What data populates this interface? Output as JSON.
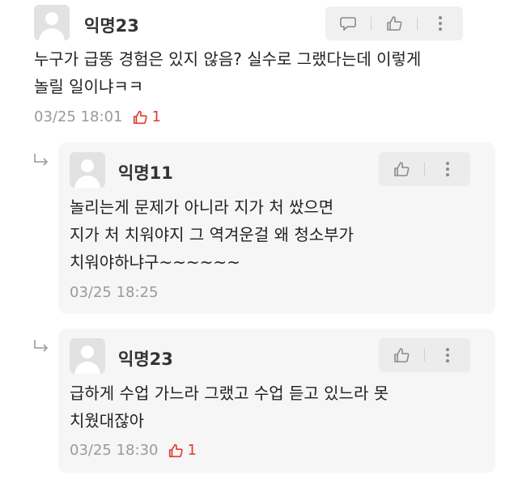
{
  "comments": [
    {
      "author": "익명23",
      "lines": [
        "누구가 급똥 경험은 있지 않음? 실수로 그랬다는데 이렇게",
        "놀릴 일이냐ㅋㅋ"
      ],
      "timestamp": "03/25 18:01",
      "likes": "1"
    }
  ],
  "replies": [
    {
      "author": "익명11",
      "lines": [
        "놀리는게 문제가 아니라 지가 처 쌌으면",
        "지가 처 치워야지 그 역겨운걸 왜 청소부가",
        "치워야하냐구~~~~~~"
      ],
      "timestamp": "03/25 18:25"
    },
    {
      "author": "익명23",
      "lines": [
        "급하게 수업 가느라 그랬고 수업 듣고 있느라 못",
        "치웠대잖아"
      ],
      "timestamp": "03/25 18:30",
      "likes": "1"
    }
  ],
  "colors": {
    "like": "#e03a2f",
    "meta": "#9a9a9a",
    "reply_bg": "#f6f6f6",
    "action_bg": "#f0f0f0"
  },
  "icons": {
    "comment": "speech-bubble-icon",
    "like": "thumbs-up-icon",
    "more": "more-vertical-icon",
    "reply": "reply-arrow-icon"
  }
}
